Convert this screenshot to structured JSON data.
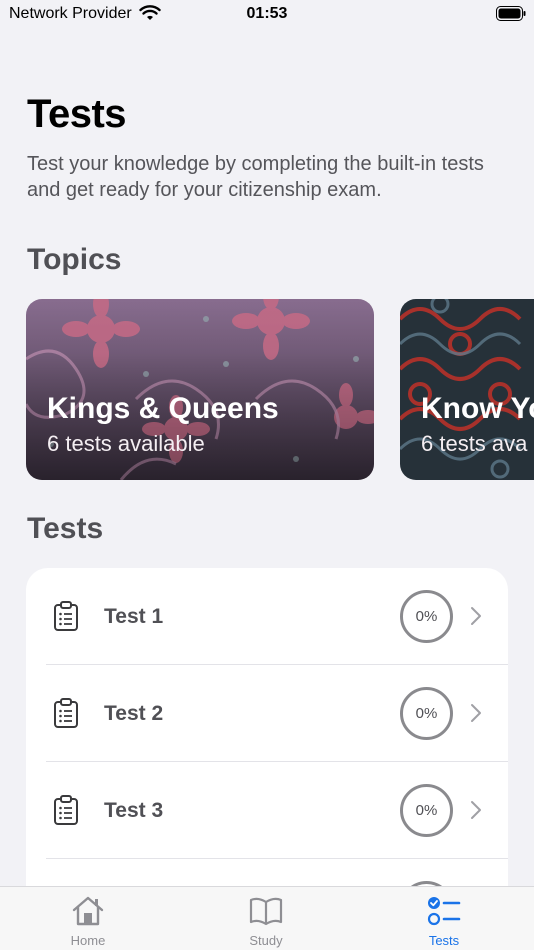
{
  "status_bar": {
    "carrier": "Network Provider",
    "time": "01:53"
  },
  "header": {
    "title": "Tests",
    "subtitle": "Test your knowledge by completing the built-in tests and get ready for your citizenship exam."
  },
  "topics": {
    "title": "Topics",
    "cards": [
      {
        "title": "Kings & Queens",
        "subtitle": "6 tests available"
      },
      {
        "title": "Know Yo",
        "subtitle": "6 tests ava"
      }
    ]
  },
  "tests": {
    "title": "Tests",
    "items": [
      {
        "label": "Test 1",
        "progress": "0%"
      },
      {
        "label": "Test 2",
        "progress": "0%"
      },
      {
        "label": "Test 3",
        "progress": "0%"
      },
      {
        "label": "",
        "progress": ""
      }
    ]
  },
  "tab_bar": {
    "items": [
      {
        "label": "Home",
        "icon": "house-icon"
      },
      {
        "label": "Study",
        "icon": "book-icon"
      },
      {
        "label": "Tests",
        "icon": "checklist-icon",
        "active": true
      }
    ]
  },
  "colors": {
    "accent": "#1a73e8",
    "background": "#f2f2f6"
  }
}
